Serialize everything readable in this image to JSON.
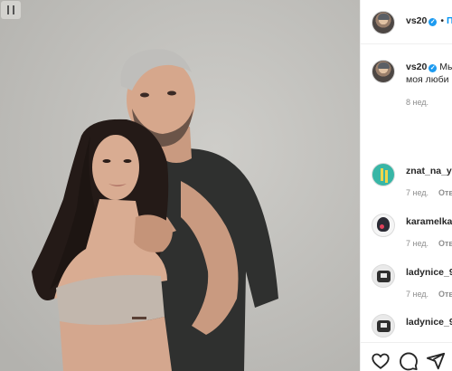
{
  "post": {
    "author": {
      "username": "vs20",
      "verified": true
    },
    "caption": {
      "username": "vs20",
      "text_line1": "Мы",
      "text_line2": "моя люби",
      "age": "8 нед."
    },
    "comments": [
      {
        "username": "znat_na_ya",
        "age": "7 нед.",
        "reply_label": "Отв"
      },
      {
        "username": "karamelka",
        "age": "7 нед.",
        "reply_label": "Отв"
      },
      {
        "username": "ladynice_9",
        "age": "7 нед.",
        "reply_label": "Отв"
      },
      {
        "username": "ladynice_9",
        "age": "",
        "reply_label": ""
      }
    ],
    "actions": [
      "heart-icon",
      "comment-icon",
      "share-icon"
    ],
    "colors": {
      "verified_badge": "#1d9bf0",
      "text_primary": "#262626",
      "text_secondary": "#8e8e8e",
      "photo_background": "#c6c5c1"
    }
  }
}
